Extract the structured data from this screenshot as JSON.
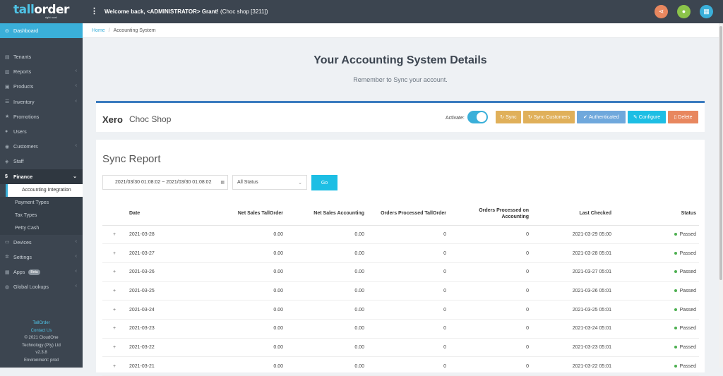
{
  "brand": {
    "name_part1": "tall",
    "name_part2": "order",
    "tagline": "right now!"
  },
  "topbar": {
    "menu_icon": "more-vertical-icon",
    "welcome_prefix": "Welcome back,",
    "welcome_user": " <ADMINISTRATOR> Grant!",
    "welcome_shop": " (Choc shop [3211])",
    "buttons": [
      {
        "icon": "share-icon",
        "glyph": "⋖",
        "color": "#e8875f"
      },
      {
        "icon": "user-icon",
        "glyph": "●",
        "color": "#8bc34a"
      },
      {
        "icon": "calendar-icon",
        "glyph": "▦",
        "color": "#3aafd9"
      }
    ]
  },
  "sidebar": {
    "dashboard": "Dashboard",
    "items": [
      {
        "label": "Tenants"
      },
      {
        "label": "Reports"
      },
      {
        "label": "Products"
      },
      {
        "label": "Inventory"
      },
      {
        "label": "Promotions"
      },
      {
        "label": "Users"
      },
      {
        "label": "Customers"
      },
      {
        "label": "Staff"
      }
    ],
    "finance": "Finance",
    "finance_sub": [
      "Accounting Integration",
      "Payment Types",
      "Tax Types",
      "Petty Cash"
    ],
    "items2": [
      {
        "label": "Devices"
      },
      {
        "label": "Settings"
      },
      {
        "label": "Apps",
        "badge": "Beta"
      },
      {
        "label": "Global Lookups"
      }
    ],
    "footer": {
      "brand": "TallOrder",
      "contact": "Contact Us",
      "copyright": "© 2021 CloudOne",
      "company": "Technology (Pty) Ltd",
      "version": "v2.3.8",
      "environment": "Environment: prod"
    }
  },
  "breadcrumb": {
    "home": "Home",
    "current": "Accounting System"
  },
  "page": {
    "title": "Your Accounting System Details",
    "subtitle": "Remember to Sync your account."
  },
  "system": {
    "name": "Xero",
    "shop": "Choc Shop",
    "activate_label": "Activate:",
    "activate_on": true,
    "buttons": {
      "sync": "Sync",
      "sync_customers": "Sync Customers",
      "authenticated": "Authenticated",
      "configure": "Configure",
      "delete": "Delete"
    },
    "colors": {
      "sync": "#e0b05a",
      "authenticated": "#6fa8dc",
      "configure": "#1dbee4",
      "delete": "#e8875f"
    }
  },
  "report": {
    "title": "Sync Report",
    "date_from": "2021/03/30 01:08:02",
    "date_sep": "~",
    "date_to": "2021/03/30 01:08:02",
    "status_value": "All Status",
    "go": "Go",
    "columns": [
      "Date",
      "Net Sales TallOrder",
      "Net Sales Accounting",
      "Orders Processed TallOrder",
      "Orders Processed on Accounting",
      "Last Checked",
      "Status"
    ],
    "rows": [
      {
        "date": "2021-03-28",
        "ns_to": "0.00",
        "ns_acc": "0.00",
        "op_to": "0",
        "op_acc": "0",
        "last": "2021-03-29 05:00",
        "status": "Passed"
      },
      {
        "date": "2021-03-27",
        "ns_to": "0.00",
        "ns_acc": "0.00",
        "op_to": "0",
        "op_acc": "0",
        "last": "2021-03-28 05:01",
        "status": "Passed"
      },
      {
        "date": "2021-03-26",
        "ns_to": "0.00",
        "ns_acc": "0.00",
        "op_to": "0",
        "op_acc": "0",
        "last": "2021-03-27 05:01",
        "status": "Passed"
      },
      {
        "date": "2021-03-25",
        "ns_to": "0.00",
        "ns_acc": "0.00",
        "op_to": "0",
        "op_acc": "0",
        "last": "2021-03-26 05:01",
        "status": "Passed"
      },
      {
        "date": "2021-03-24",
        "ns_to": "0.00",
        "ns_acc": "0.00",
        "op_to": "0",
        "op_acc": "0",
        "last": "2021-03-25 05:01",
        "status": "Passed"
      },
      {
        "date": "2021-03-23",
        "ns_to": "0.00",
        "ns_acc": "0.00",
        "op_to": "0",
        "op_acc": "0",
        "last": "2021-03-24 05:01",
        "status": "Passed"
      },
      {
        "date": "2021-03-22",
        "ns_to": "0.00",
        "ns_acc": "0.00",
        "op_to": "0",
        "op_acc": "0",
        "last": "2021-03-23 05:01",
        "status": "Passed"
      },
      {
        "date": "2021-03-21",
        "ns_to": "0.00",
        "ns_acc": "0.00",
        "op_to": "0",
        "op_acc": "0",
        "last": "2021-03-22 05:01",
        "status": "Passed"
      }
    ],
    "passed_color": "#4caf50"
  }
}
